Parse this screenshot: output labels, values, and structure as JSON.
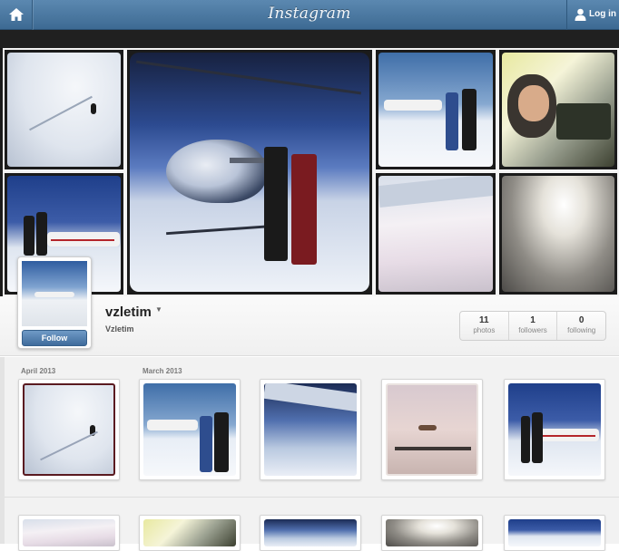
{
  "topbar": {
    "home_icon": "home-icon",
    "logo_text": "Instagram",
    "login_icon": "user-silhouette-icon",
    "login_label": "Log in"
  },
  "profile": {
    "username": "vzletim",
    "fullname": "Vzletim",
    "follow_label": "Follow",
    "stats": [
      {
        "value": "11",
        "label": "photos"
      },
      {
        "value": "1",
        "label": "followers"
      },
      {
        "value": "0",
        "label": "following"
      }
    ]
  },
  "grid": {
    "months": [
      "April 2013",
      "March 2013"
    ]
  },
  "colors": {
    "topbar": "#4a7aa4",
    "follow_button": "#5586b6"
  }
}
